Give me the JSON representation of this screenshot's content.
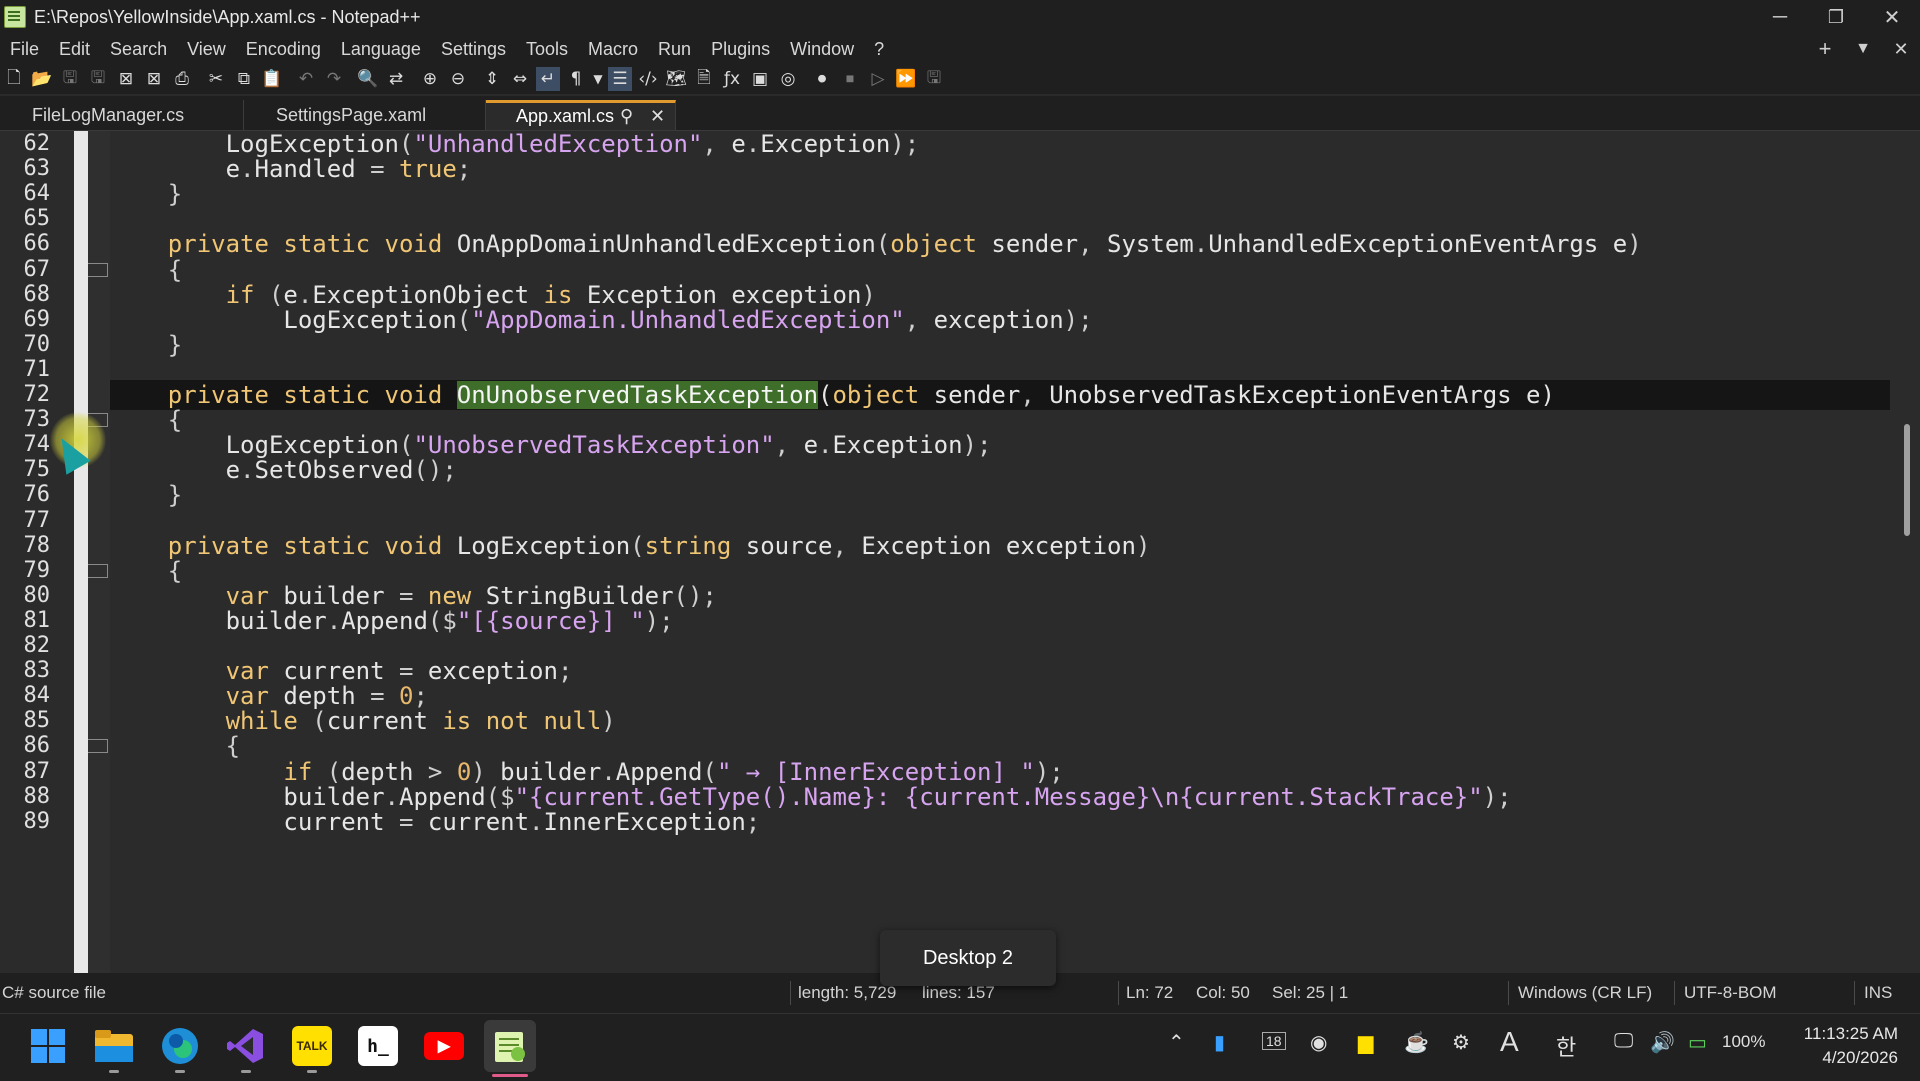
{
  "window": {
    "title": "E:\\Repos\\YellowInside\\App.xaml.cs - Notepad++",
    "minimize_glyph": "─",
    "restore_glyph": "❐",
    "close_glyph": "✕"
  },
  "menu": {
    "items": [
      "File",
      "Edit",
      "Search",
      "View",
      "Encoding",
      "Language",
      "Settings",
      "Tools",
      "Macro",
      "Run",
      "Plugins",
      "Window",
      "?"
    ],
    "right_icons": [
      "+",
      "▼",
      "✕"
    ]
  },
  "toolbar": {
    "icons": [
      "new-file-icon",
      "open-file-icon",
      "save-icon",
      "save-all-icon",
      "close-icon",
      "close-all-icon",
      "print-icon",
      "cut-icon",
      "copy-icon",
      "paste-icon",
      "undo-icon",
      "redo-icon",
      "find-icon",
      "replace-icon",
      "zoom-in-icon",
      "zoom-out-icon",
      "sync-vertical-icon",
      "sync-horizontal-icon",
      "word-wrap-icon",
      "show-all-chars-icon",
      "indent-guide-icon",
      "language-icon",
      "folder-as-workspace-icon",
      "doc-map-icon",
      "function-list-icon",
      "document-list-icon",
      "monitor-icon",
      "record-macro-icon",
      "stop-macro-icon",
      "play-macro-icon",
      "play-multiple-icon",
      "save-macro-icon"
    ]
  },
  "tabs": [
    {
      "label": "FileLogManager.cs",
      "active": false
    },
    {
      "label": "SettingsPage.xaml",
      "active": false
    },
    {
      "label": "App.xaml.cs",
      "active": true
    }
  ],
  "editor": {
    "current_line": 72,
    "lines": [
      {
        "no": "62",
        "tokens": [
          [
            "        ",
            ""
          ],
          [
            "LogException",
            ""
          ],
          [
            "(",
            "punct"
          ],
          [
            "\"UnhandledException\"",
            "str"
          ],
          [
            ", ",
            "punct"
          ],
          [
            "e",
            ""
          ],
          [
            ".",
            "punct"
          ],
          [
            "Exception",
            ""
          ],
          [
            ");",
            "punct"
          ]
        ]
      },
      {
        "no": "63",
        "tokens": [
          [
            "        ",
            ""
          ],
          [
            "e",
            ""
          ],
          [
            ".",
            "punct"
          ],
          [
            "Handled ",
            ""
          ],
          [
            "= ",
            "punct"
          ],
          [
            "true",
            "kw"
          ],
          [
            ";",
            "punct"
          ]
        ]
      },
      {
        "no": "64",
        "tokens": [
          [
            "    ",
            ""
          ],
          [
            "}",
            "punct"
          ]
        ]
      },
      {
        "no": "65",
        "tokens": []
      },
      {
        "no": "66",
        "tokens": [
          [
            "    ",
            ""
          ],
          [
            "private static void ",
            "kw"
          ],
          [
            "OnAppDomainUnhandledException",
            ""
          ],
          [
            "(",
            "punct"
          ],
          [
            "object ",
            "kw"
          ],
          [
            "sender",
            ""
          ],
          [
            ", ",
            "punct"
          ],
          [
            "System",
            ""
          ],
          [
            ".",
            "punct"
          ],
          [
            "UnhandledExceptionEventArgs e",
            ""
          ],
          [
            ")",
            "punct"
          ]
        ]
      },
      {
        "no": "67",
        "tokens": [
          [
            "    ",
            ""
          ],
          [
            "{",
            "punct"
          ]
        ]
      },
      {
        "no": "68",
        "tokens": [
          [
            "        ",
            ""
          ],
          [
            "if ",
            "kw"
          ],
          [
            "(",
            "punct"
          ],
          [
            "e",
            ""
          ],
          [
            ".",
            "punct"
          ],
          [
            "ExceptionObject ",
            ""
          ],
          [
            "is ",
            "kw"
          ],
          [
            "Exception exception",
            ""
          ],
          [
            ")",
            "punct"
          ]
        ]
      },
      {
        "no": "69",
        "tokens": [
          [
            "            ",
            ""
          ],
          [
            "LogException",
            ""
          ],
          [
            "(",
            "punct"
          ],
          [
            "\"AppDomain.UnhandledException\"",
            "str"
          ],
          [
            ", ",
            "punct"
          ],
          [
            "exception",
            ""
          ],
          [
            ");",
            "punct"
          ]
        ]
      },
      {
        "no": "70",
        "tokens": [
          [
            "    ",
            ""
          ],
          [
            "}",
            "punct"
          ]
        ]
      },
      {
        "no": "71",
        "tokens": []
      },
      {
        "no": "72",
        "tokens": [
          [
            "    ",
            ""
          ],
          [
            "private static void ",
            "kw"
          ],
          [
            "OnUnobservedTaskException",
            "hl"
          ],
          [
            "(",
            ""
          ],
          [
            "object ",
            "kw"
          ],
          [
            "sender",
            ""
          ],
          [
            ", ",
            "punct"
          ],
          [
            "UnobservedTaskExceptionEventArgs e",
            ""
          ],
          [
            ")",
            ""
          ]
        ]
      },
      {
        "no": "73",
        "tokens": [
          [
            "    ",
            ""
          ],
          [
            "{",
            "punct"
          ]
        ]
      },
      {
        "no": "74",
        "tokens": [
          [
            "        ",
            ""
          ],
          [
            "LogException",
            ""
          ],
          [
            "(",
            "punct"
          ],
          [
            "\"UnobservedTaskException\"",
            "str"
          ],
          [
            ", ",
            "punct"
          ],
          [
            "e",
            ""
          ],
          [
            ".",
            "punct"
          ],
          [
            "Exception",
            ""
          ],
          [
            ");",
            "punct"
          ]
        ]
      },
      {
        "no": "75",
        "tokens": [
          [
            "        ",
            ""
          ],
          [
            "e",
            ""
          ],
          [
            ".",
            "punct"
          ],
          [
            "SetObserved",
            ""
          ],
          [
            "();",
            "punct"
          ]
        ]
      },
      {
        "no": "76",
        "tokens": [
          [
            "    ",
            ""
          ],
          [
            "}",
            "punct"
          ]
        ]
      },
      {
        "no": "77",
        "tokens": []
      },
      {
        "no": "78",
        "tokens": [
          [
            "    ",
            ""
          ],
          [
            "private static void ",
            "kw"
          ],
          [
            "LogException",
            ""
          ],
          [
            "(",
            "punct"
          ],
          [
            "string ",
            "kw"
          ],
          [
            "source",
            ""
          ],
          [
            ", ",
            "punct"
          ],
          [
            "Exception exception",
            ""
          ],
          [
            ")",
            "punct"
          ]
        ]
      },
      {
        "no": "79",
        "tokens": [
          [
            "    ",
            ""
          ],
          [
            "{",
            "punct"
          ]
        ]
      },
      {
        "no": "80",
        "tokens": [
          [
            "        ",
            ""
          ],
          [
            "var ",
            "kw"
          ],
          [
            "builder ",
            ""
          ],
          [
            "= ",
            "punct"
          ],
          [
            "new ",
            "kw"
          ],
          [
            "StringBuilder",
            ""
          ],
          [
            "();",
            "punct"
          ]
        ]
      },
      {
        "no": "81",
        "tokens": [
          [
            "        ",
            ""
          ],
          [
            "builder",
            ""
          ],
          [
            ".",
            "punct"
          ],
          [
            "Append",
            ""
          ],
          [
            "($",
            "punct"
          ],
          [
            "\"[{source}] \"",
            "str"
          ],
          [
            ");",
            "punct"
          ]
        ]
      },
      {
        "no": "82",
        "tokens": []
      },
      {
        "no": "83",
        "tokens": [
          [
            "        ",
            ""
          ],
          [
            "var ",
            "kw"
          ],
          [
            "current ",
            ""
          ],
          [
            "= ",
            "punct"
          ],
          [
            "exception",
            ""
          ],
          [
            ";",
            "punct"
          ]
        ]
      },
      {
        "no": "84",
        "tokens": [
          [
            "        ",
            ""
          ],
          [
            "var ",
            "kw"
          ],
          [
            "depth ",
            ""
          ],
          [
            "= ",
            "punct"
          ],
          [
            "0",
            "num"
          ],
          [
            ";",
            "punct"
          ]
        ]
      },
      {
        "no": "85",
        "tokens": [
          [
            "        ",
            ""
          ],
          [
            "while ",
            "kw"
          ],
          [
            "(",
            "punct"
          ],
          [
            "current ",
            ""
          ],
          [
            "is not null",
            "kw"
          ],
          [
            ")",
            "punct"
          ]
        ]
      },
      {
        "no": "86",
        "tokens": [
          [
            "        ",
            ""
          ],
          [
            "{",
            "punct"
          ]
        ]
      },
      {
        "no": "87",
        "tokens": [
          [
            "            ",
            ""
          ],
          [
            "if ",
            "kw"
          ],
          [
            "(",
            "punct"
          ],
          [
            "depth ",
            ""
          ],
          [
            "> ",
            "punct"
          ],
          [
            "0",
            "num"
          ],
          [
            ") ",
            "punct"
          ],
          [
            "builder",
            ""
          ],
          [
            ".",
            "punct"
          ],
          [
            "Append",
            ""
          ],
          [
            "(",
            "punct"
          ],
          [
            "\" → [InnerException] \"",
            "str"
          ],
          [
            ");",
            "punct"
          ]
        ]
      },
      {
        "no": "88",
        "tokens": [
          [
            "            ",
            ""
          ],
          [
            "builder",
            ""
          ],
          [
            ".",
            "punct"
          ],
          [
            "Append",
            ""
          ],
          [
            "($",
            "punct"
          ],
          [
            "\"{current.GetType().Name}: {current.Message}\\n{current.StackTrace}\"",
            "str"
          ],
          [
            ");",
            "punct"
          ]
        ]
      },
      {
        "no": "89",
        "tokens": [
          [
            "            ",
            ""
          ],
          [
            "current ",
            ""
          ],
          [
            "= ",
            "punct"
          ],
          [
            "current",
            ""
          ],
          [
            ".",
            "punct"
          ],
          [
            "InnerException",
            ""
          ],
          [
            ";",
            "punct"
          ]
        ]
      }
    ]
  },
  "statusbar": {
    "filetype": "C# source file",
    "length": "length: 5,729",
    "lines": "lines: 157",
    "ln": "Ln: 72",
    "col": "Col: 50",
    "sel": "Sel: 25 | 1",
    "eol": "Windows (CR LF)",
    "encoding": "UTF-8-BOM",
    "mode": "INS"
  },
  "tooltip": {
    "text": "Desktop 2"
  },
  "taskbar": {
    "apps": [
      {
        "name": "start-button",
        "glyph": "",
        "color": "#3aa0ff"
      },
      {
        "name": "file-explorer-icon",
        "glyph": "",
        "color": "#f0c040"
      },
      {
        "name": "edge-icon",
        "glyph": "",
        "color": "#1fb0d0"
      },
      {
        "name": "visual-studio-icon",
        "glyph": "",
        "color": "#9b5cf0"
      },
      {
        "name": "kakaotalk-icon",
        "glyph": "TALK",
        "color": "#ffe000"
      },
      {
        "name": "terminal-icon",
        "glyph": "h_",
        "color": "#ffffff"
      },
      {
        "name": "youtube-icon",
        "glyph": "▶",
        "color": "#ff0000"
      },
      {
        "name": "notepad-plus-plus-icon",
        "glyph": "",
        "color": "#9bd36b"
      }
    ],
    "tray": {
      "battery": "100%",
      "date_badge": "18",
      "ime_glyph": "A",
      "hangul_glyph": "한"
    },
    "time": "11:13:25 AM",
    "date": "4/20/2026"
  }
}
